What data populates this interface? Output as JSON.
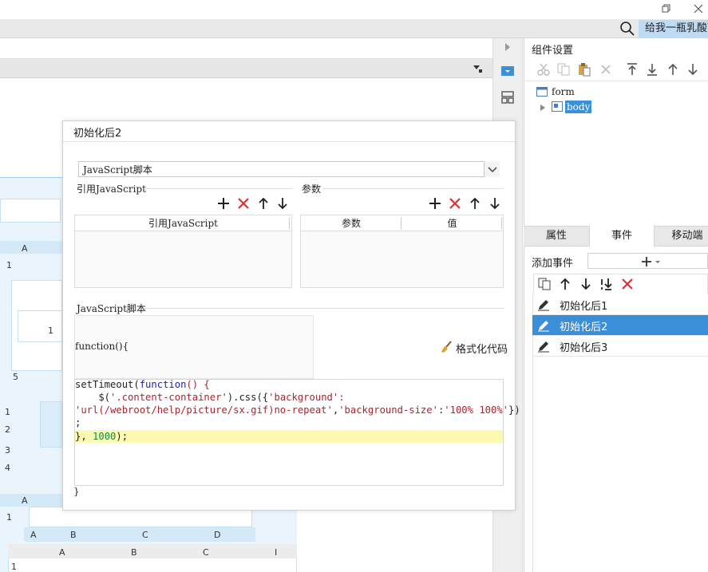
{
  "user": {
    "name": "给我一瓶乳酸菌"
  },
  "right_panel": {
    "title": "组件设置",
    "tree": {
      "root": "form",
      "child": "body"
    },
    "tabs": [
      "属性",
      "事件",
      "移动端"
    ],
    "active_tab": "事件",
    "add_event_label": "添加事件",
    "events": [
      {
        "label": "初始化后1",
        "selected": false
      },
      {
        "label": "初始化后2",
        "selected": true
      },
      {
        "label": "初始化后3",
        "selected": false
      }
    ]
  },
  "dialog": {
    "title": "初始化后2",
    "type_value": "JavaScript脚本",
    "ref_section": "引用JavaScript",
    "ref_table_header": "引用JavaScript",
    "param_section": "参数",
    "param_headers": [
      "参数",
      "值"
    ],
    "script_section": "JavaScript脚本",
    "fn_open": "function(){",
    "format_button": "格式化代码",
    "fn_close": "}",
    "code": {
      "line1_a": "setTimeout(",
      "line1_kw": "function",
      "line1_b": "() {",
      "line2_a": "    $(",
      "line2_str": "'.content-container'",
      "line2_b": ").css({",
      "line2_str2": "'background':",
      "line3_str": "'url(/webroot/help/picture/sx.gif)no-repeat'",
      "line3_b": ",",
      "line3_str2": "'background-size'",
      "line3_c": ":",
      "line3_str3": "'100% 100%'",
      "line3_d": "})",
      "line4": ";",
      "line5_a": "}, ",
      "line5_num": "1000",
      "line5_b": ");"
    }
  },
  "sheet": {
    "col_headers": [
      "A",
      "B",
      "C",
      "D"
    ],
    "col_headers2": [
      "A",
      "B",
      "C",
      "I"
    ],
    "rows": [
      "1",
      "1",
      "5",
      "1",
      "2",
      "3",
      "4",
      "1",
      "1"
    ]
  },
  "colors": {
    "accent": "#3b8fd9",
    "delete": "#e03030",
    "highlight": "#fbfab0"
  }
}
